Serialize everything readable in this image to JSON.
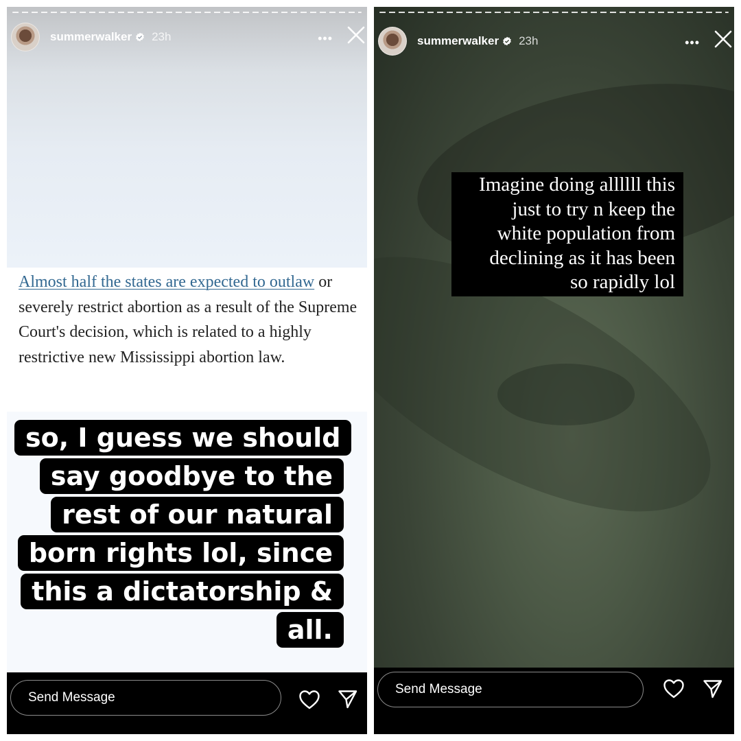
{
  "stories": [
    {
      "username": "summerwalker",
      "time": "23h",
      "more_label": "•••",
      "article": {
        "link_text": "Almost half the states are expected to outlaw",
        "body_text": " or severely restrict abortion as a result of the Supreme Court's decision, which is related to a highly restrictive new Mississippi abortion law."
      },
      "caption": "so, I guess we should say goodbye to the rest of our natural born rights lol, since this a dictatorship & all.",
      "send_placeholder": "Send Message"
    },
    {
      "username": "summerwalker",
      "time": "23h",
      "more_label": "•••",
      "caption": "Imagine doing allllll this\njust to try n keep the\nwhite population from\ndeclining  as it has been\nso rapidly lol",
      "send_placeholder": "Send Message"
    }
  ],
  "icons": {
    "verified": "verified-badge-icon",
    "more": "more-options-icon",
    "close": "close-icon",
    "like": "heart-icon",
    "share": "paper-plane-icon"
  },
  "colors": {
    "link": "#326891",
    "story_bg_dark": "#3a4436",
    "footer": "#000000"
  }
}
